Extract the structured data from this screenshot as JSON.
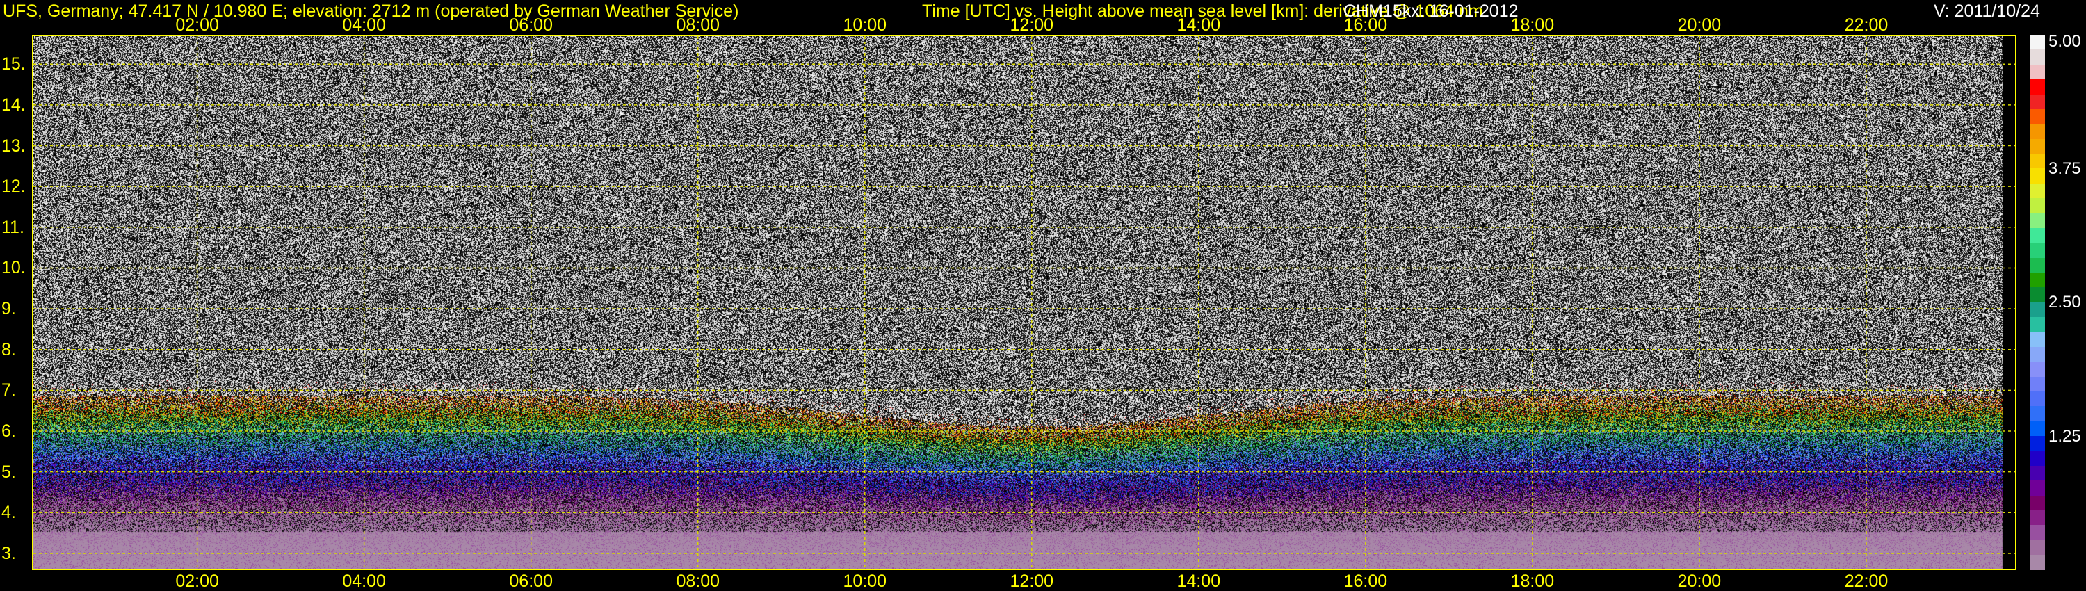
{
  "header": {
    "station": "UFS, Germany; 47.417 N / 10.980 E; elevation: 2712 m  (operated by German Weather Service)",
    "axes_title": "Time [UTC] vs. Height above mean sea level [km]: derivative @ 1064 nm",
    "instrument": "CHM15kx: 16-01-2012",
    "version": "V: 2011/10/24"
  },
  "chart_data": {
    "type": "heatmap",
    "title": "Time [UTC] vs. Height above mean sea level [km]: derivative @ 1064 nm",
    "xlabel": "Time [UTC]",
    "ylabel": "Height above mean sea level [km]",
    "x_ticks": [
      "02:00",
      "04:00",
      "06:00",
      "08:00",
      "10:00",
      "12:00",
      "14:00",
      "16:00",
      "18:00",
      "20:00",
      "22:00"
    ],
    "x_tick_hours": [
      2,
      4,
      6,
      8,
      10,
      12,
      14,
      16,
      18,
      20,
      22
    ],
    "xlim_hours": [
      0.02,
      23.8
    ],
    "y_ticks": [
      "3.",
      "4.",
      "5.",
      "6.",
      "7.",
      "8.",
      "9.",
      "10.",
      "11.",
      "12.",
      "13.",
      "14.",
      "15."
    ],
    "y_tick_values": [
      3,
      4,
      5,
      6,
      7,
      8,
      9,
      10,
      11,
      12,
      13,
      14,
      15
    ],
    "ylim": [
      2.59,
      15.72
    ],
    "grid": true,
    "colorbar": {
      "range": [
        0,
        5
      ],
      "labels": [
        "5.00",
        "3.75",
        "2.50",
        "1.25"
      ],
      "label_values": [
        5,
        3.75,
        2.5,
        1.25
      ],
      "colors": [
        "#f5f5f5",
        "#e6dcdc",
        "#f0c0c4",
        "#ff0000",
        "#f02424",
        "#fa5a00",
        "#f59600",
        "#f5aa00",
        "#f8c800",
        "#f8e000",
        "#e0f030",
        "#c0f040",
        "#88f080",
        "#40e898",
        "#28d078",
        "#1cbc50",
        "#20a000",
        "#0a8c30",
        "#1aa08c",
        "#28c0a0",
        "#88c0f8",
        "#88a8f8",
        "#8890f8",
        "#7080f8",
        "#5070f8",
        "#3070f8",
        "#0060f8",
        "#0020e0",
        "#2000c8",
        "#4800b0",
        "#700098",
        "#780068",
        "#882088",
        "#9850a0",
        "#a070a0",
        "#a888a8"
      ],
      "notes": "bottom layer ~3.2 km lilac; purple/blue signal 3.3-6 km; noise above ~8 km"
    }
  }
}
